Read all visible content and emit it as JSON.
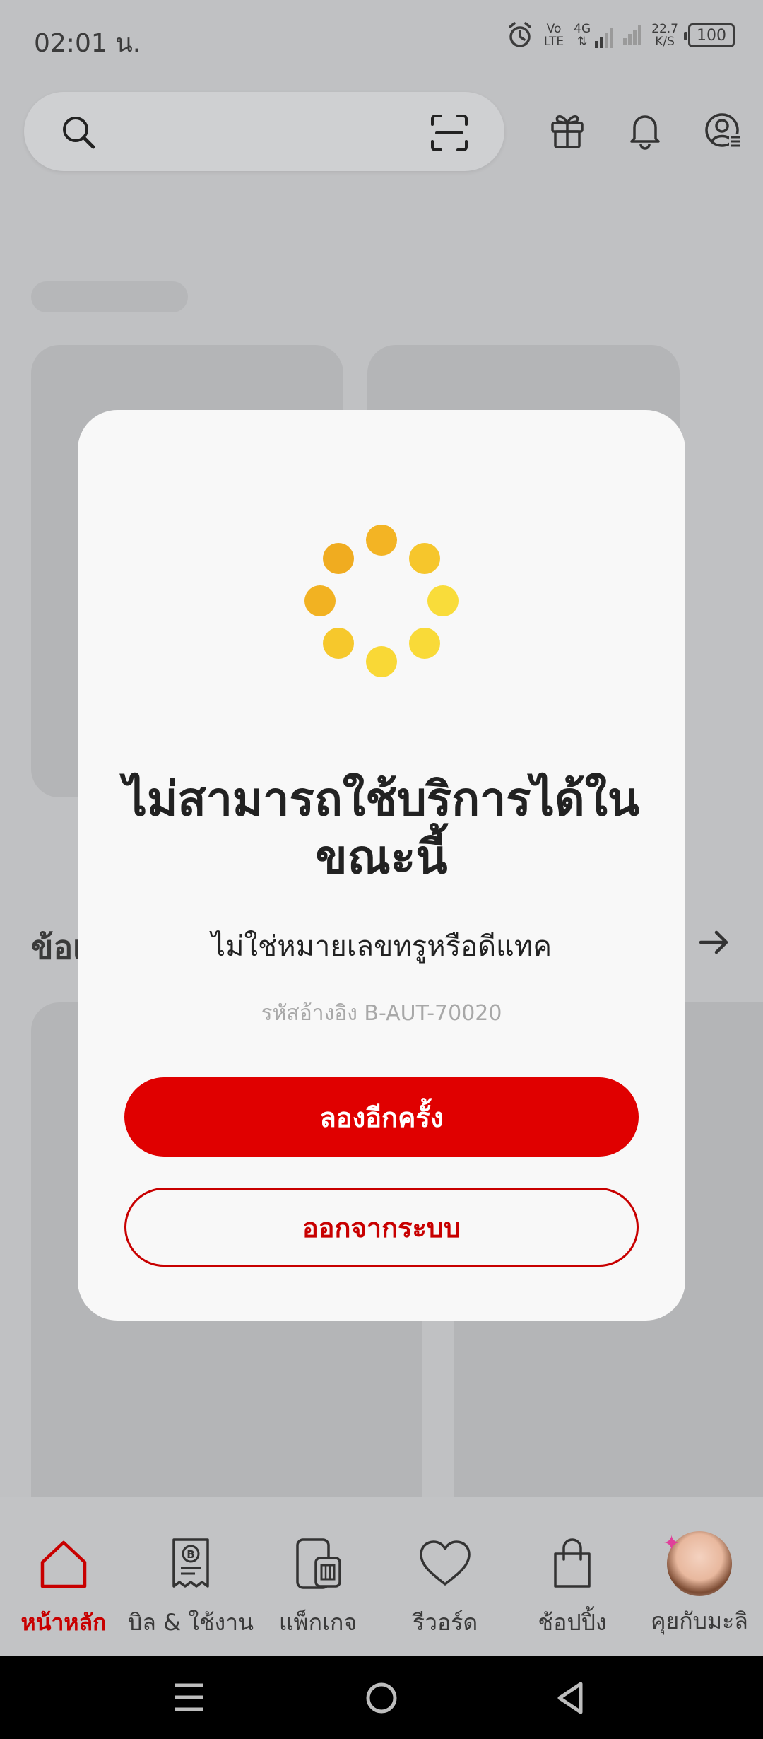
{
  "status_bar": {
    "time": "02:01 น.",
    "volte_top": "Vo",
    "volte_bottom": "LTE",
    "network": "4G",
    "net_speed_value": "22.7",
    "net_speed_unit": "K/S",
    "battery": "100"
  },
  "header": {
    "search_placeholder": "",
    "icons": [
      "search-icon",
      "scan-icon",
      "gift-icon",
      "bell-icon",
      "profile-icon"
    ]
  },
  "background": {
    "section_title": "ข้อเ"
  },
  "dialog": {
    "title": "ไม่สามารถใช้บริการได้ในขณะนี้",
    "message": "ไม่ใช่หมายเลขทรูหรือดีแทค",
    "reference": "รหัสอ้างอิง B-AUT-70020",
    "primary_button": "ลองอีกครั้ง",
    "secondary_button": "ออกจากระบบ",
    "spinner_colors": [
      "#f0b020",
      "#f4c428",
      "#f8d838"
    ]
  },
  "bottom_nav": {
    "items": [
      {
        "label": "หน้าหลัก",
        "icon": "home-icon",
        "active": true
      },
      {
        "label": "บิล & ใช้งาน",
        "icon": "bill-icon",
        "active": false
      },
      {
        "label": "แพ็กเกจ",
        "icon": "package-icon",
        "active": false
      },
      {
        "label": "รีวอร์ด",
        "icon": "heart-icon",
        "active": false
      },
      {
        "label": "ช้อปปิ้ง",
        "icon": "shopping-bag-icon",
        "active": false
      },
      {
        "label": "คุยกับมะลิ",
        "icon": "chat-avatar-icon",
        "active": false
      }
    ]
  },
  "colors": {
    "accent": "#e00000",
    "overlay_bg": "#c0c1c3",
    "dialog_bg": "#f8f8f8"
  }
}
